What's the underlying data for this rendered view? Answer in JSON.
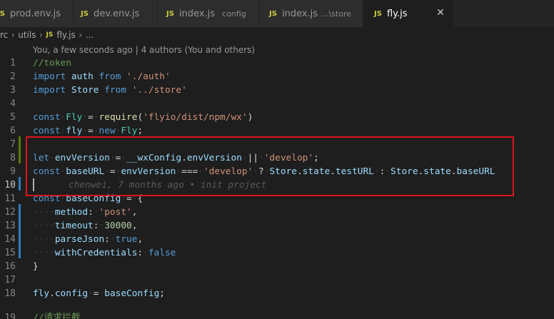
{
  "tabs": [
    {
      "badge": "JS",
      "name": "prod.env.js",
      "sub": "",
      "active": false
    },
    {
      "badge": "JS",
      "name": "dev.env.js",
      "sub": "",
      "active": false
    },
    {
      "badge": "JS",
      "name": "index.js",
      "sub": "config",
      "active": false
    },
    {
      "badge": "JS",
      "name": "index.js",
      "sub": "...\\store",
      "active": false
    },
    {
      "badge": "JS",
      "name": "fly.js",
      "sub": "",
      "active": true,
      "close": "✕"
    }
  ],
  "breadcrumb": {
    "items": [
      "rc",
      "utils"
    ],
    "file_badge": "JS",
    "file": "fly.js",
    "trail": "...",
    "separator": "›"
  },
  "codelens": "You, a few seconds ago | 4 authors (You and others)",
  "blame": "chenwei, 7 months ago • init project",
  "current_line": 10,
  "line_numbers": [
    "1",
    "2",
    "3",
    "4",
    "5",
    "6",
    "7",
    "8",
    "9",
    "10",
    "11",
    "12",
    "13",
    "14",
    "15",
    "16",
    "17",
    "18",
    "19"
  ],
  "code": {
    "l1": "//token",
    "l2": [
      "import",
      "auth",
      "from",
      "'./auth'"
    ],
    "l3": [
      "import",
      "Store",
      "from",
      "'../store'"
    ],
    "l5": [
      "const",
      "Fly",
      "=",
      "require",
      "(",
      "'flyio/dist/npm/wx'",
      ")"
    ],
    "l6": [
      "const",
      "fly",
      "=",
      "new",
      "Fly",
      ";"
    ],
    "l8": [
      "let",
      "envVersion",
      "=",
      "__wxConfig",
      ".",
      "envVersion",
      "||",
      "'develop'",
      ";"
    ],
    "l9": [
      "const",
      "baseURL",
      "=",
      "envVersion",
      "===",
      "'develop'",
      "?",
      "Store",
      ".",
      "state",
      ".",
      "testURL",
      ":",
      "Store",
      ".",
      "state",
      ".",
      "baseURL"
    ],
    "l11": [
      "const",
      "baseConfig",
      "=",
      "{"
    ],
    "l12": [
      "method",
      ":",
      "'post'",
      ","
    ],
    "l13": [
      "timeout",
      ":",
      "30000",
      ","
    ],
    "l14": [
      "parseJson",
      ":",
      "true",
      ","
    ],
    "l15": [
      "withCredentials",
      ":",
      "false"
    ],
    "l16": "}",
    "l18": [
      "fly",
      ".",
      "config",
      "=",
      "baseConfig",
      ";"
    ],
    "l19": "//请求拦截"
  },
  "colors": {
    "highlight_box": "#d9141b",
    "keyword": "#569cd6",
    "string": "#ce9178",
    "js_badge": "#cbcb41"
  }
}
